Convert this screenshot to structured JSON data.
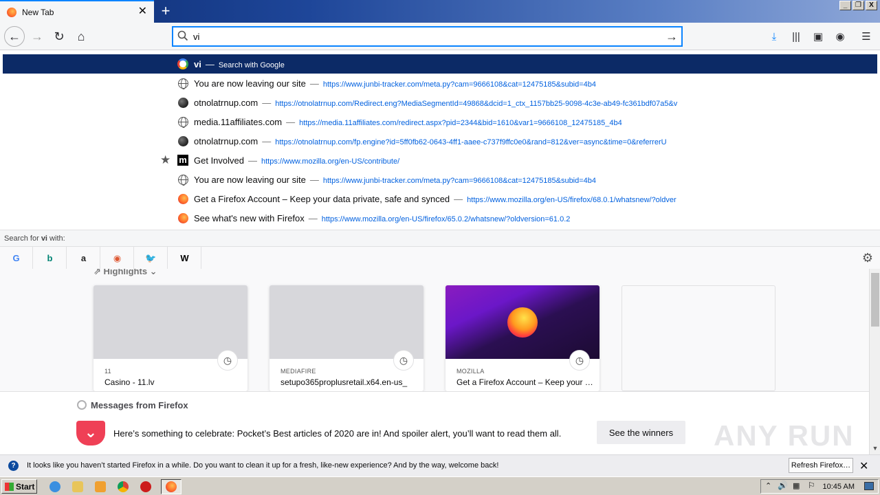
{
  "window": {
    "controls": [
      "_",
      "❐",
      "X"
    ]
  },
  "tab": {
    "title": "New Tab"
  },
  "urlbar": {
    "value": "vi"
  },
  "dropdown": {
    "rows": [
      {
        "icon": "google-icon",
        "title": "vi",
        "url": "",
        "hint": "Search with Google",
        "starred": false,
        "selected": true
      },
      {
        "icon": "globe-icon",
        "title": "You are now leaving our site",
        "url": "https://www.junbi-tracker.com/meta.py?cam=9666108&cat=12475185&subid=4b4",
        "starred": false
      },
      {
        "icon": "dot-icon",
        "title": "otnolatrnup.com",
        "url": "https://otnolatrnup.com/Redirect.eng?MediaSegmentId=49868&dcid=1_ctx_1157bb25-9098-4c3e-ab49-fc361bdf07a5&v",
        "starred": false
      },
      {
        "icon": "globe-icon",
        "title": "media.11affiliates.com",
        "url": "https://media.11affiliates.com/redirect.aspx?pid=2344&bid=1610&var1=9666108_12475185_4b4",
        "starred": false
      },
      {
        "icon": "dot-icon",
        "title": "otnolatrnup.com",
        "url": "https://otnolatrnup.com/fp.engine?id=5ff0fb62-0643-4ff1-aaee-c737f9ffc0e0&rand=812&ver=async&time=0&referrerU",
        "starred": false
      },
      {
        "icon": "mozilla-m-icon",
        "title": "Get Involved",
        "url": "https://www.mozilla.org/en-US/contribute/",
        "starred": true
      },
      {
        "icon": "globe-icon",
        "title": "You are now leaving our site",
        "url": "https://www.junbi-tracker.com/meta.py?cam=9666108&cat=12475185&subid=4b4",
        "starred": false
      },
      {
        "icon": "firefox-icon",
        "title": "Get a Firefox Account – Keep your data private, safe and synced",
        "url": "https://www.mozilla.org/en-US/firefox/68.0.1/whatsnew/?oldver",
        "starred": false
      },
      {
        "icon": "firefox-icon",
        "title": "See what's new with Firefox",
        "url": "https://www.mozilla.org/en-US/firefox/65.0.2/whatsnew/?oldversion=61.0.2",
        "starred": false
      }
    ],
    "separator": "—",
    "search_for_prefix": "Search for ",
    "search_for_term": "vi",
    "search_for_suffix": " with:",
    "engines": [
      {
        "name": "google",
        "glyph": "G",
        "color": "#4285f4"
      },
      {
        "name": "bing",
        "glyph": "b",
        "color": "#008373"
      },
      {
        "name": "amazon",
        "glyph": "a",
        "color": "#222222"
      },
      {
        "name": "duckduckgo",
        "glyph": "◉",
        "color": "#de5833"
      },
      {
        "name": "twitter",
        "glyph": "🐦",
        "color": "#1da1f2"
      },
      {
        "name": "wikipedia",
        "glyph": "W",
        "color": "#000000"
      }
    ]
  },
  "highlights": {
    "title": "Highlights",
    "cards": [
      {
        "source": "11",
        "name": "Casino - 11.lv",
        "thumb": "grey"
      },
      {
        "source": "MEDIAFIRE",
        "name": "setupo365proplusretail.x64.en-us_",
        "thumb": "grey"
      },
      {
        "source": "MOZILLA",
        "name": "Get a Firefox Account – Keep your …",
        "thumb": "mozilla"
      }
    ]
  },
  "messages": {
    "title": "Messages from Firefox",
    "text": "Here’s something to celebrate: Pocket’s Best articles of 2020 are in! And spoiler alert, you’ll want to read them all.",
    "button": "See the winners",
    "watermark": "ANY RUN"
  },
  "notification": {
    "text": "It looks like you haven’t started Firefox in a while. Do you want to clean it up for a fresh, like-new experience? And by the way, welcome back!",
    "button": "Refresh Firefox…"
  },
  "taskbar": {
    "start": "Start",
    "time": "10:45 AM"
  }
}
